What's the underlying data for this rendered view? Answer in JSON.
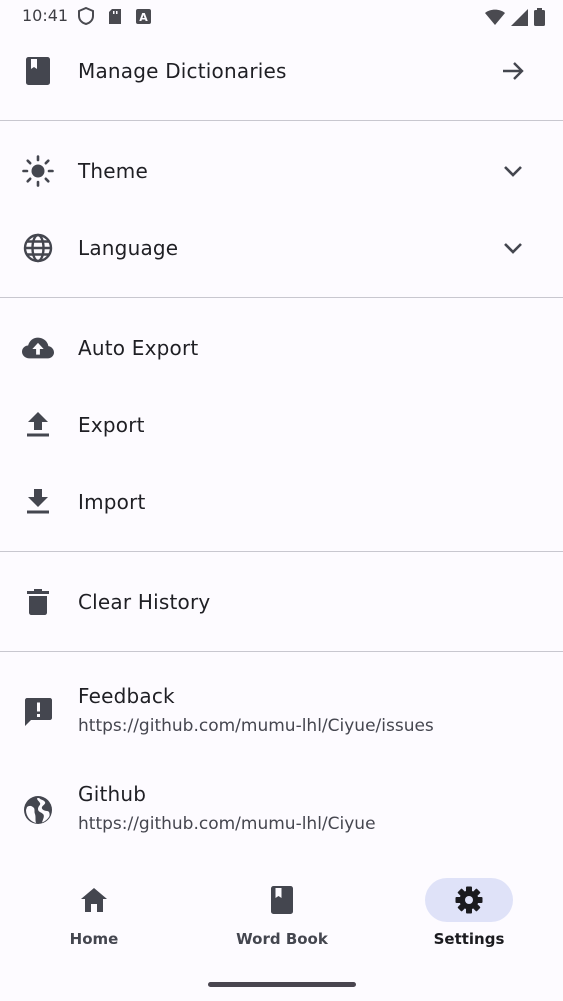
{
  "status_bar": {
    "time": "10:41",
    "left_icons": [
      "shield-icon",
      "sd-card-icon",
      "font-a-icon"
    ],
    "right_icons": [
      "wifi-icon",
      "cell-signal-icon",
      "battery-icon"
    ]
  },
  "settings": {
    "manage_dictionaries": {
      "label": "Manage Dictionaries",
      "icon": "book-icon",
      "trail": "arrow-right-icon"
    },
    "theme": {
      "label": "Theme",
      "icon": "sun-icon",
      "trail": "chevron-down-icon"
    },
    "language": {
      "label": "Language",
      "icon": "globe-icon",
      "trail": "chevron-down-icon"
    },
    "auto_export": {
      "label": "Auto Export",
      "icon": "cloud-upload-icon"
    },
    "export": {
      "label": "Export",
      "icon": "upload-icon"
    },
    "import": {
      "label": "Import",
      "icon": "download-icon"
    },
    "clear_history": {
      "label": "Clear History",
      "icon": "trash-icon"
    },
    "feedback": {
      "label": "Feedback",
      "subtitle": "https://github.com/mumu-lhl/Ciyue/issues",
      "icon": "feedback-icon"
    },
    "github": {
      "label": "Github",
      "subtitle": "https://github.com/mumu-lhl/Ciyue",
      "icon": "public-globe-icon"
    }
  },
  "nav": {
    "items": [
      {
        "label": "Home",
        "icon": "home-icon",
        "active": false
      },
      {
        "label": "Word Book",
        "icon": "book-icon",
        "active": false
      },
      {
        "label": "Settings",
        "icon": "gear-icon",
        "active": true
      }
    ]
  },
  "colors": {
    "background": "#fdfbff",
    "icon": "#44464f",
    "active_indicator": "#dfe2f8",
    "divider": "#c8c7cf"
  }
}
